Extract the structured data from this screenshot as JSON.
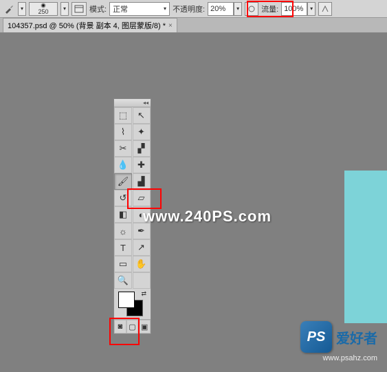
{
  "optionsBar": {
    "brushSize": "250",
    "modeLabel": "模式:",
    "modeValue": "正常",
    "opacityLabel": "不透明度:",
    "opacityValue": "20%",
    "flowLabel": "流量:",
    "flowValue": "100%"
  },
  "tab": {
    "title": "104357.psd @ 50% (背景 副本 4, 图层蒙版/8) *",
    "close": "×"
  },
  "tools": {
    "collapse": "◂◂",
    "items": [
      {
        "name": "marquee-tool",
        "glyph": "⬚"
      },
      {
        "name": "move-tool",
        "glyph": "↖"
      },
      {
        "name": "lasso-tool",
        "glyph": "⌇"
      },
      {
        "name": "magic-wand-tool",
        "glyph": "✦"
      },
      {
        "name": "crop-tool",
        "glyph": "✂"
      },
      {
        "name": "slice-tool",
        "glyph": "▞"
      },
      {
        "name": "eyedropper-tool",
        "glyph": "💧"
      },
      {
        "name": "healing-brush-tool",
        "glyph": "✚"
      },
      {
        "name": "brush-tool",
        "glyph": "🖌",
        "selected": true
      },
      {
        "name": "clone-stamp-tool",
        "glyph": "▟"
      },
      {
        "name": "history-brush-tool",
        "glyph": "↺"
      },
      {
        "name": "eraser-tool",
        "glyph": "▱"
      },
      {
        "name": "gradient-tool",
        "glyph": "◧"
      },
      {
        "name": "blur-tool",
        "glyph": "◐"
      },
      {
        "name": "dodge-tool",
        "glyph": "☼"
      },
      {
        "name": "pen-tool",
        "glyph": "✒"
      },
      {
        "name": "type-tool",
        "glyph": "T"
      },
      {
        "name": "path-selection-tool",
        "glyph": "↗"
      },
      {
        "name": "rectangle-tool",
        "glyph": "▭"
      },
      {
        "name": "hand-tool",
        "glyph": "✋"
      },
      {
        "name": "zoom-tool",
        "glyph": "🔍"
      }
    ],
    "extra": [
      {
        "name": "quick-mask-toggle",
        "glyph": "◙"
      },
      {
        "name": "screen-mode-1",
        "glyph": "▢"
      },
      {
        "name": "screen-mode-2",
        "glyph": "▣"
      }
    ],
    "swapIcon": "⇄"
  },
  "colors": {
    "foreground": "#ffffff",
    "background": "#000000"
  },
  "canvas": {
    "docColor": "#7dd3d8"
  },
  "watermark": {
    "text": "www.240PS.com"
  },
  "logo": {
    "badge": "PS",
    "text": "爱好者",
    "url": "www.psahz.com"
  }
}
